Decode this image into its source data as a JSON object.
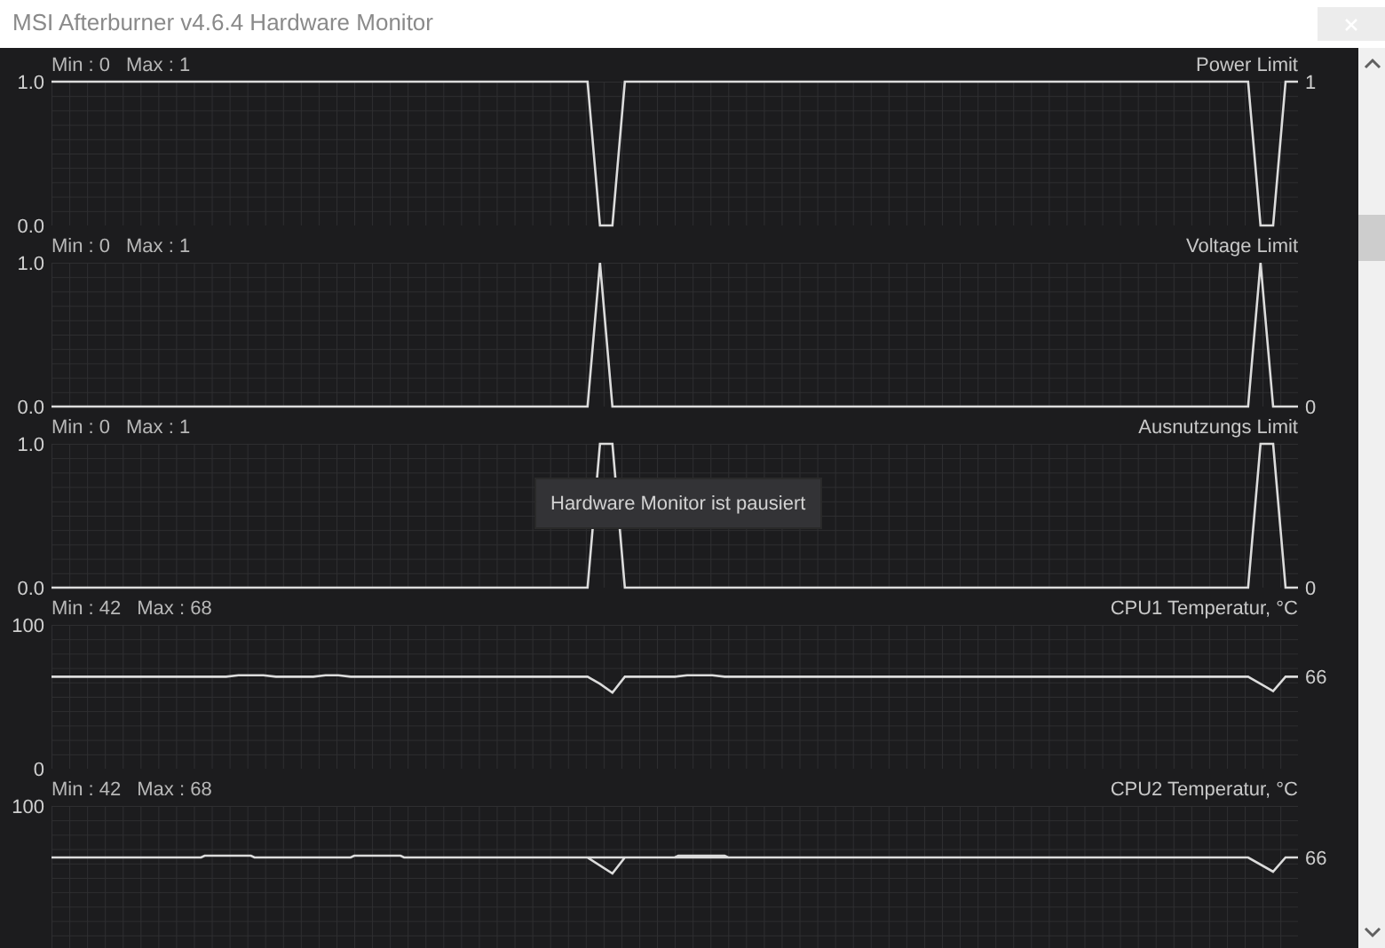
{
  "window": {
    "title": "MSI Afterburner v4.6.4 Hardware Monitor"
  },
  "graphs": [
    {
      "min": "Min : 0",
      "max": "Max : 1",
      "current": "1",
      "chart_data": {
        "type": "line",
        "ylim": [
          0,
          1
        ],
        "yticks": [
          {
            "value": 0,
            "label": "0.0"
          },
          {
            "value": 1,
            "label": "1.0"
          }
        ],
        "categories": [
          null,
          null,
          null,
          null,
          null,
          null,
          null,
          null,
          null,
          null,
          null,
          null,
          null,
          null,
          null,
          null,
          null,
          null,
          null,
          null,
          null,
          null,
          null,
          null,
          null,
          null,
          null,
          null,
          null,
          null,
          null,
          null,
          null,
          null,
          null,
          null,
          null,
          null,
          null,
          null,
          null,
          null,
          null,
          null,
          null,
          null,
          null,
          null,
          null,
          null,
          null,
          null,
          null,
          null,
          null,
          null,
          null,
          null,
          null,
          null,
          null,
          null,
          null,
          null,
          null,
          null,
          null,
          null,
          null,
          null,
          null,
          null,
          null,
          null,
          null,
          null,
          null,
          null,
          null,
          null,
          null,
          null,
          null,
          null,
          null,
          null,
          null,
          null,
          null,
          null,
          null,
          null,
          null,
          null,
          null,
          null,
          null,
          null,
          null,
          null,
          null
        ],
        "series": [
          {
            "name": "Power Limit",
            "color": "#dcdcdc",
            "values": [
              1,
              1,
              1,
              1,
              1,
              1,
              1,
              1,
              1,
              1,
              1,
              1,
              1,
              1,
              1,
              1,
              1,
              1,
              1,
              1,
              1,
              1,
              1,
              1,
              1,
              1,
              1,
              1,
              1,
              1,
              1,
              1,
              1,
              1,
              1,
              1,
              1,
              1,
              1,
              1,
              1,
              1,
              1,
              1,
              0,
              0,
              1,
              1,
              1,
              1,
              1,
              1,
              1,
              1,
              1,
              1,
              1,
              1,
              1,
              1,
              1,
              1,
              1,
              1,
              1,
              1,
              1,
              1,
              1,
              1,
              1,
              1,
              1,
              1,
              1,
              1,
              1,
              1,
              1,
              1,
              1,
              1,
              1,
              1,
              1,
              1,
              1,
              1,
              1,
              1,
              1,
              1,
              1,
              1,
              1,
              1,
              1,
              0,
              0,
              1,
              1
            ]
          }
        ]
      }
    },
    {
      "min": "Min : 0",
      "max": "Max : 1",
      "current": "0",
      "chart_data": {
        "type": "line",
        "ylim": [
          0,
          1
        ],
        "yticks": [
          {
            "value": 0,
            "label": "0.0"
          },
          {
            "value": 1,
            "label": "1.0"
          }
        ],
        "categories": [
          null,
          null,
          null,
          null,
          null,
          null,
          null,
          null,
          null,
          null,
          null,
          null,
          null,
          null,
          null,
          null,
          null,
          null,
          null,
          null,
          null,
          null,
          null,
          null,
          null,
          null,
          null,
          null,
          null,
          null,
          null,
          null,
          null,
          null,
          null,
          null,
          null,
          null,
          null,
          null,
          null,
          null,
          null,
          null,
          null,
          null,
          null,
          null,
          null,
          null,
          null,
          null,
          null,
          null,
          null,
          null,
          null,
          null,
          null,
          null,
          null,
          null,
          null,
          null,
          null,
          null,
          null,
          null,
          null,
          null,
          null,
          null,
          null,
          null,
          null,
          null,
          null,
          null,
          null,
          null,
          null,
          null,
          null,
          null,
          null,
          null,
          null,
          null,
          null,
          null,
          null,
          null,
          null,
          null,
          null,
          null,
          null,
          null,
          null,
          null,
          null
        ],
        "series": [
          {
            "name": "Voltage Limit",
            "color": "#dcdcdc",
            "values": [
              0,
              0,
              0,
              0,
              0,
              0,
              0,
              0,
              0,
              0,
              0,
              0,
              0,
              0,
              0,
              0,
              0,
              0,
              0,
              0,
              0,
              0,
              0,
              0,
              0,
              0,
              0,
              0,
              0,
              0,
              0,
              0,
              0,
              0,
              0,
              0,
              0,
              0,
              0,
              0,
              0,
              0,
              0,
              0,
              1,
              0,
              0,
              0,
              0,
              0,
              0,
              0,
              0,
              0,
              0,
              0,
              0,
              0,
              0,
              0,
              0,
              0,
              0,
              0,
              0,
              0,
              0,
              0,
              0,
              0,
              0,
              0,
              0,
              0,
              0,
              0,
              0,
              0,
              0,
              0,
              0,
              0,
              0,
              0,
              0,
              0,
              0,
              0,
              0,
              0,
              0,
              0,
              0,
              0,
              0,
              0,
              0,
              1,
              0,
              0,
              0
            ]
          }
        ]
      }
    },
    {
      "min": "Min : 0",
      "max": "Max : 1",
      "current": "0",
      "chart_data": {
        "type": "line",
        "ylim": [
          0,
          1
        ],
        "yticks": [
          {
            "value": 0,
            "label": "0.0"
          },
          {
            "value": 1,
            "label": "1.0"
          }
        ],
        "categories": [
          null,
          null,
          null,
          null,
          null,
          null,
          null,
          null,
          null,
          null,
          null,
          null,
          null,
          null,
          null,
          null,
          null,
          null,
          null,
          null,
          null,
          null,
          null,
          null,
          null,
          null,
          null,
          null,
          null,
          null,
          null,
          null,
          null,
          null,
          null,
          null,
          null,
          null,
          null,
          null,
          null,
          null,
          null,
          null,
          null,
          null,
          null,
          null,
          null,
          null,
          null,
          null,
          null,
          null,
          null,
          null,
          null,
          null,
          null,
          null,
          null,
          null,
          null,
          null,
          null,
          null,
          null,
          null,
          null,
          null,
          null,
          null,
          null,
          null,
          null,
          null,
          null,
          null,
          null,
          null,
          null,
          null,
          null,
          null,
          null,
          null,
          null,
          null,
          null,
          null,
          null,
          null,
          null,
          null,
          null,
          null,
          null,
          null,
          null,
          null,
          null
        ],
        "series": [
          {
            "name": "Ausnutzungs Limit",
            "color": "#dcdcdc",
            "values": [
              0,
              0,
              0,
              0,
              0,
              0,
              0,
              0,
              0,
              0,
              0,
              0,
              0,
              0,
              0,
              0,
              0,
              0,
              0,
              0,
              0,
              0,
              0,
              0,
              0,
              0,
              0,
              0,
              0,
              0,
              0,
              0,
              0,
              0,
              0,
              0,
              0,
              0,
              0,
              0,
              0,
              0,
              0,
              0,
              1,
              1,
              0,
              0,
              0,
              0,
              0,
              0,
              0,
              0,
              0,
              0,
              0,
              0,
              0,
              0,
              0,
              0,
              0,
              0,
              0,
              0,
              0,
              0,
              0,
              0,
              0,
              0,
              0,
              0,
              0,
              0,
              0,
              0,
              0,
              0,
              0,
              0,
              0,
              0,
              0,
              0,
              0,
              0,
              0,
              0,
              0,
              0,
              0,
              0,
              0,
              0,
              0,
              1,
              1,
              0,
              0
            ]
          }
        ]
      }
    },
    {
      "min": "Min : 42",
      "max": "Max : 68",
      "current": "66",
      "chart_data": {
        "type": "line",
        "ylim": [
          0,
          100
        ],
        "yticks": [
          {
            "value": 0,
            "label": "0"
          },
          {
            "value": 100,
            "label": "100"
          }
        ],
        "categories": [
          null,
          null,
          null,
          null,
          null,
          null,
          null,
          null,
          null,
          null,
          null,
          null,
          null,
          null,
          null,
          null,
          null,
          null,
          null,
          null,
          null,
          null,
          null,
          null,
          null,
          null,
          null,
          null,
          null,
          null,
          null,
          null,
          null,
          null,
          null,
          null,
          null,
          null,
          null,
          null,
          null,
          null,
          null,
          null,
          null,
          null,
          null,
          null,
          null,
          null,
          null,
          null,
          null,
          null,
          null,
          null,
          null,
          null,
          null,
          null,
          null,
          null,
          null,
          null,
          null,
          null,
          null,
          null,
          null,
          null,
          null,
          null,
          null,
          null,
          null,
          null,
          null,
          null,
          null,
          null,
          null,
          null,
          null,
          null,
          null,
          null,
          null,
          null,
          null,
          null,
          null,
          null,
          null,
          null,
          null,
          null,
          null,
          null,
          null,
          null,
          null
        ],
        "series": [
          {
            "name": "CPU1 Temperatur, °C",
            "color": "#dcdcdc",
            "values": [
              64,
              64,
              64,
              64,
              64,
              64,
              64,
              64,
              64,
              64,
              64,
              64,
              64,
              64,
              64,
              65,
              65,
              65,
              64,
              64,
              64,
              64,
              65,
              65,
              64,
              64,
              64,
              64,
              64,
              64,
              64,
              64,
              64,
              64,
              64,
              64,
              64,
              64,
              64,
              64,
              64,
              64,
              64,
              64,
              59,
              53,
              64,
              64,
              64,
              64,
              64,
              65,
              65,
              65,
              64,
              64,
              64,
              64,
              64,
              64,
              64,
              64,
              64,
              64,
              64,
              64,
              64,
              64,
              64,
              64,
              64,
              64,
              64,
              64,
              64,
              64,
              64,
              64,
              64,
              64,
              64,
              64,
              64,
              64,
              64,
              64,
              64,
              64,
              64,
              64,
              64,
              64,
              64,
              64,
              64,
              64,
              64,
              59,
              54,
              64,
              64
            ]
          }
        ]
      }
    },
    {
      "min": "Min : 42",
      "max": "Max : 68",
      "current": "66",
      "title": "CPU2 Temperatur, °C",
      "axis_label": "100"
    }
  ],
  "tooltip": "Hardware Monitor ist pausiert"
}
